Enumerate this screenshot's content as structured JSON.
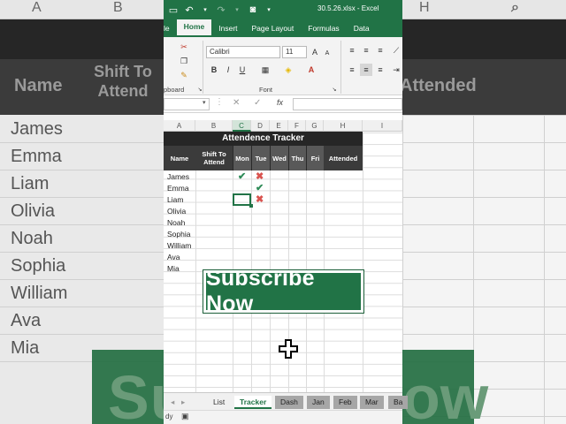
{
  "title_bar": {
    "filename": "30.5.26.xlsx - Excel"
  },
  "ribbon": {
    "tabs": [
      {
        "label": "le"
      },
      {
        "label": "Home"
      },
      {
        "label": "Insert"
      },
      {
        "label": "Page Layout"
      },
      {
        "label": "Formulas"
      },
      {
        "label": "Data"
      }
    ],
    "font_name": "Calibri",
    "font_size": "11",
    "group_clipboard": "pboard",
    "group_font": "Font"
  },
  "formula_bar": {
    "fx": "fx"
  },
  "columns": [
    "A",
    "B",
    "C",
    "D",
    "E",
    "F",
    "G",
    "H",
    "I"
  ],
  "tracker": {
    "title": "Attendence Tracker",
    "headers": {
      "name": "Name",
      "shift": "Shift To Attend",
      "mon": "Mon",
      "tue": "Tue",
      "wed": "Wed",
      "thu": "Thu",
      "fri": "Fri",
      "attended": "Attended"
    },
    "names": [
      "James",
      "Emma",
      "Liam",
      "Olivia",
      "Noah",
      "Sophia",
      "William",
      "Ava",
      "Mia"
    ]
  },
  "overlay": {
    "subscribe": "Subscribe Now"
  },
  "sheet_tabs": [
    "List",
    "Tracker",
    "Dash",
    "Jan",
    "Feb",
    "Mar",
    "Ba"
  ],
  "status_bar": {
    "text": "dy"
  },
  "background": {
    "col_a": "A",
    "col_b": "B",
    "col_h": "H",
    "name_header": "Name",
    "shift_header": "Shift To Attend",
    "attended_header": "Attended",
    "names": [
      "James",
      "Emma",
      "Liam",
      "Olivia",
      "Noah",
      "Sophia",
      "William",
      "Ava",
      "Mia"
    ],
    "banner_left": "Su",
    "banner_right": "ow"
  },
  "colors": {
    "excel_green": "#217346",
    "check": "#2e8b57",
    "cross": "#d9534f"
  }
}
